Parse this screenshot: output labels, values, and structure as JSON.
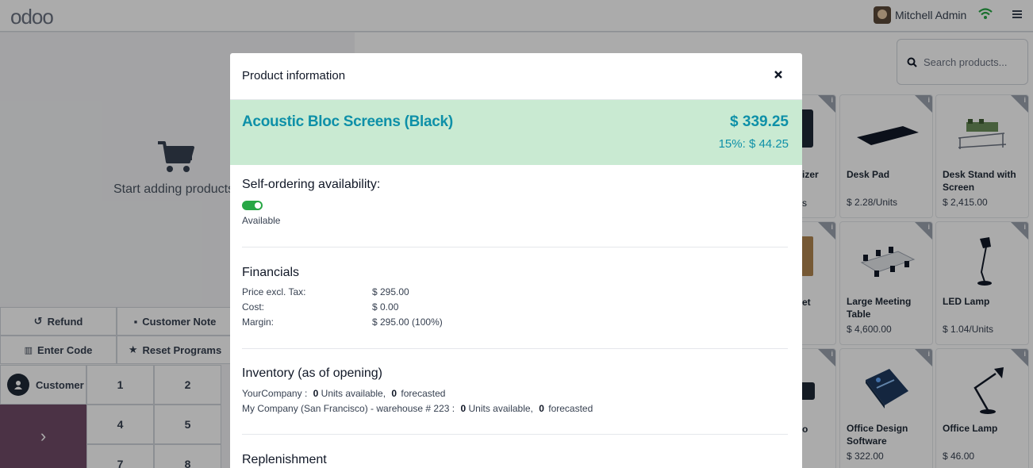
{
  "topbar": {
    "logo": "odoo",
    "user_name": "Mitchell Admin"
  },
  "left": {
    "empty_cart_text": "Start adding products",
    "refund": "Refund",
    "customer_note": "Customer Note",
    "enter_code": "Enter Code",
    "reset_programs": "Reset Programs",
    "customer": "Customer",
    "keys": [
      "1",
      "2",
      "4",
      "5",
      "7",
      "8"
    ]
  },
  "search": {
    "placeholder": "Search products..."
  },
  "products": [
    {
      "name": "Desk Pad",
      "price": "$ 2.28/Units"
    },
    {
      "name": "Desk Stand with Screen",
      "price": "$ 2,415.00"
    },
    {
      "name": "Large Meeting Table",
      "price": "$ 4,600.00"
    },
    {
      "name": "LED Lamp",
      "price": "$ 1.04/Units"
    },
    {
      "name": "Office Design Software",
      "price": "$ 322.00"
    },
    {
      "name": "Office Lamp",
      "price": "$ 46.00"
    }
  ],
  "partial_products": {
    "p1": "izer",
    "p1_price": "s",
    "p2": "et",
    "p3": "o"
  },
  "modal": {
    "title": "Product information",
    "product_name": "Acoustic Bloc Screens (Black)",
    "price": "$ 339.25",
    "tax_line": "15%: $ 44.25",
    "self_ordering_title": "Self-ordering availability:",
    "availability": "Available",
    "financials_title": "Financials",
    "financials": [
      {
        "label": "Price excl. Tax:",
        "value": "$ 295.00"
      },
      {
        "label": "Cost:",
        "value": "$ 0.00"
      },
      {
        "label": "Margin:",
        "value": "$ 295.00 (100%)"
      }
    ],
    "inventory_title": "Inventory (as of opening)",
    "inventory": [
      {
        "location": "YourCompany :",
        "available": "0",
        "available_label": "Units available,",
        "forecasted": "0",
        "forecasted_label": "forecasted"
      },
      {
        "location": "My Company (San Francisco) - warehouse # 223 :",
        "available": "0",
        "available_label": "Units available,",
        "forecasted": "0",
        "forecasted_label": "forecasted"
      }
    ],
    "replenishment_title": "Replenishment"
  },
  "colors": {
    "brand": "#714B67",
    "accent": "#0e90a8",
    "hero_bg": "#c9ead2",
    "toggle_on": "#28a745"
  },
  "icons": [
    "cart-icon",
    "wifi-icon",
    "menu-icon",
    "search-icon",
    "close-icon",
    "refund-icon",
    "note-icon",
    "barcode-icon",
    "star-icon",
    "user-icon",
    "chevron-right-icon",
    "info-icon"
  ]
}
